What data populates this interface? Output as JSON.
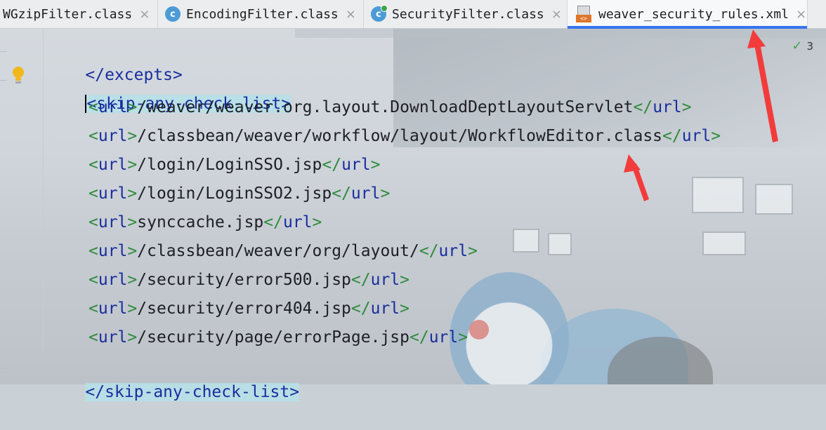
{
  "tabs": [
    {
      "label": "WGzipFilter.class",
      "icon": "class-file-icon",
      "active": false
    },
    {
      "label": "EncodingFilter.class",
      "icon": "class-file-icon",
      "active": false
    },
    {
      "label": "SecurityFilter.class",
      "icon": "class-file-icon",
      "active": false
    },
    {
      "label": "weaver_security_rules.xml",
      "icon": "xml-file-icon",
      "active": true
    }
  ],
  "close_glyph": "×",
  "inspection": {
    "count": "3",
    "icon": "checkmark-icon"
  },
  "code": {
    "excepts_close": "</excepts>",
    "list_open": {
      "lt": "<",
      "name": "skip-any-check-list",
      "gt": ">"
    },
    "url_tag": "url",
    "urls": [
      "/weaver/weaver.org.layout.DownloadDeptLayoutServlet",
      "/classbean/weaver/workflow/layout/WorkflowEditor.class",
      "/login/LoginSSO.jsp",
      "/login/LoginSSO2.jsp",
      "synccache.jsp",
      "/classbean/weaver/org/layout/",
      "/security/error500.jsp",
      "/security/error404.jsp",
      "/security/page/errorPage.jsp"
    ],
    "list_close": {
      "lt": "</",
      "name": "skip-any-check-list",
      "gt": ">"
    }
  },
  "colors": {
    "tag": "#1a2d9c",
    "bracket": "#2f8a3b",
    "highlight": "#b5e0e9",
    "arrow": "#f23c3c",
    "active_tab_underline": "#3574f0"
  }
}
